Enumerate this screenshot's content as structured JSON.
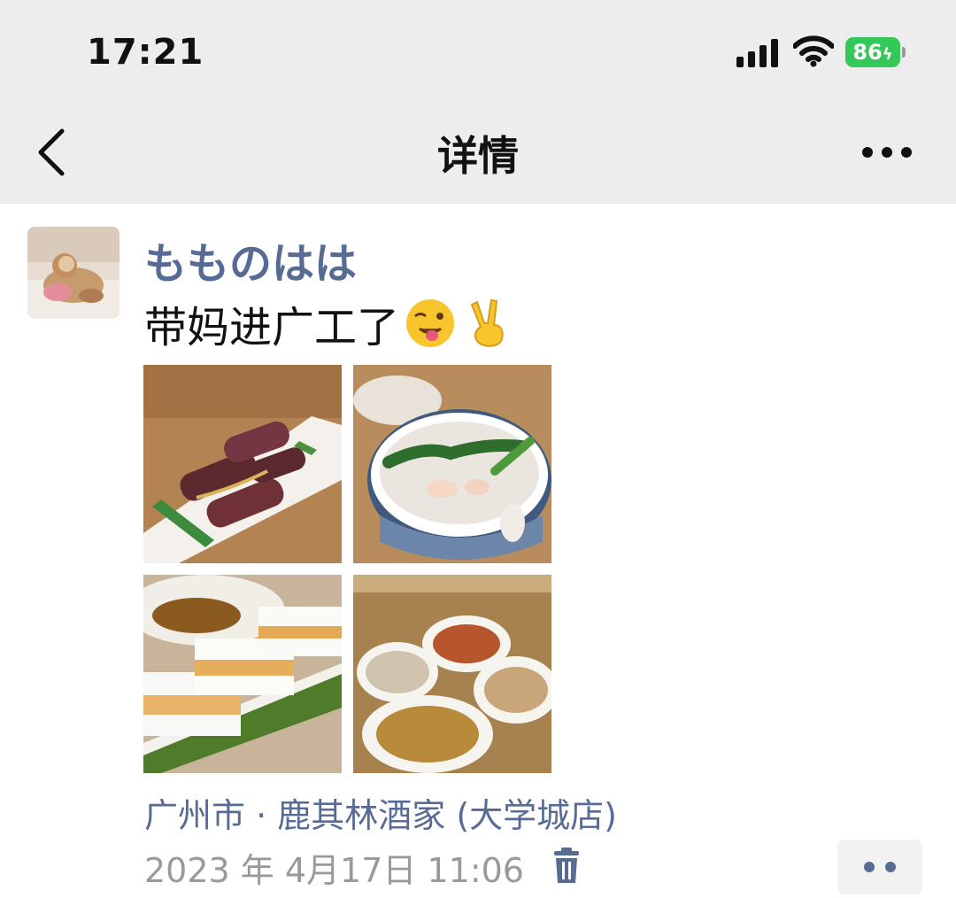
{
  "status_bar": {
    "time": "17:21",
    "battery": "86"
  },
  "nav": {
    "title": "详情"
  },
  "post": {
    "username": "もものはは",
    "text": "带妈进广工了",
    "emojis": [
      "winking-tongue-emoji",
      "victory-hand-emoji"
    ],
    "photos": [
      "photo-braised-eggplant",
      "photo-fish-congee",
      "photo-layer-cakes",
      "photo-dim-sum-steamer"
    ],
    "location": "广州市 · 鹿其林酒家 (大学城店)",
    "datetime": "2023 年 4月17日  11:06"
  },
  "colors": {
    "link": "#576b95",
    "nav_bg": "#ededed",
    "battery": "#34c759",
    "meta": "#9a9a9a"
  }
}
